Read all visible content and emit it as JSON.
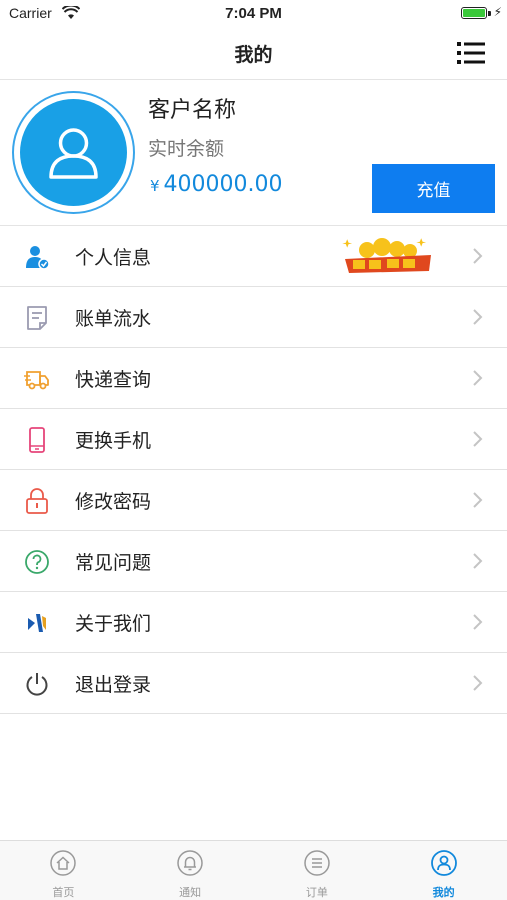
{
  "status_bar": {
    "carrier": "Carrier",
    "time": "7:04 PM"
  },
  "nav": {
    "title": "我的",
    "menu_icon": "list-icon"
  },
  "profile": {
    "customer_name": "客户名称",
    "balance_label": "实时余额",
    "currency": "¥",
    "balance": "400000.00",
    "recharge_label": "充值"
  },
  "menu": [
    {
      "label": "个人信息",
      "icon": "person-verified-icon",
      "color": "#1a8fe0"
    },
    {
      "label": "账单流水",
      "icon": "bill-icon",
      "color": "#9b9bb0"
    },
    {
      "label": "快递查询",
      "icon": "truck-icon",
      "color": "#f0a030"
    },
    {
      "label": "更换手机",
      "icon": "phone-icon",
      "color": "#e6457a"
    },
    {
      "label": "修改密码",
      "icon": "lock-icon",
      "color": "#ea5a4a"
    },
    {
      "label": "常见问题",
      "icon": "question-icon",
      "color": "#3aa86a"
    },
    {
      "label": "关于我们",
      "icon": "brand-logo-icon",
      "color": "#1a5bb0"
    },
    {
      "label": "退出登录",
      "icon": "power-icon",
      "color": "#444444"
    }
  ],
  "tabs": [
    {
      "label": "首页",
      "icon": "home-icon",
      "active": false
    },
    {
      "label": "通知",
      "icon": "bell-icon",
      "active": false
    },
    {
      "label": "订单",
      "icon": "list-icon",
      "active": false
    },
    {
      "label": "我的",
      "icon": "user-icon",
      "active": true
    }
  ],
  "colors": {
    "accent": "#1289dc",
    "button": "#0e7df0",
    "avatar": "#19a0e6"
  }
}
